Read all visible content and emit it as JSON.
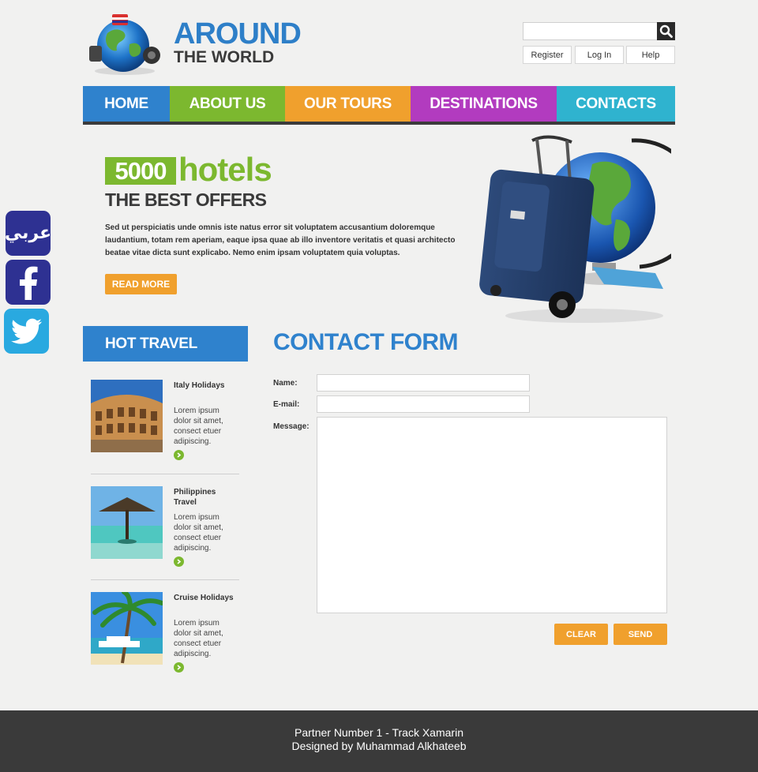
{
  "logo": {
    "line1": "AROUND",
    "line2": "THE WORLD"
  },
  "search": {
    "placeholder": "",
    "value": ""
  },
  "top_links": [
    "Register",
    "Log In",
    "Help"
  ],
  "nav": [
    {
      "label": "HOME",
      "color": "#2f82cd"
    },
    {
      "label": "ABOUT US",
      "color": "#7cb82f"
    },
    {
      "label": "OUR TOURS",
      "color": "#f0a02d"
    },
    {
      "label": "DESTINATIONS",
      "color": "#b23bbf"
    },
    {
      "label": "CONTACTS",
      "color": "#2fb3cf"
    }
  ],
  "hero": {
    "number": "5000",
    "word": "hotels",
    "subtitle": "THE BEST OFFERS",
    "text": "Sed ut perspiciatis unde omnis iste natus error sit voluptatem accusantium doloremque laudantium, totam rem aperiam, eaque ipsa quae ab illo inventore veritatis et quasi architecto beatae vitae dicta sunt explicabo. Nemo enim ipsam voluptatem quia voluptas.",
    "button": "READ MORE"
  },
  "social": {
    "arabic_label": "عربي",
    "colors": {
      "arabic": "#2e3192",
      "facebook": "#2e3192",
      "twitter": "#29a9e0"
    }
  },
  "sidebar": {
    "title": "HOT TRAVEL",
    "items": [
      {
        "title": "Italy Holidays",
        "desc": "Lorem ipsum dolor sit amet, consect etuer adipiscing."
      },
      {
        "title": "Philippines Travel",
        "desc": "Lorem ipsum dolor sit amet, consect etuer adipiscing."
      },
      {
        "title": "Cruise Holidays",
        "desc": "Lorem ipsum dolor sit amet, consect etuer adipiscing."
      }
    ]
  },
  "contact": {
    "title": "CONTACT FORM",
    "name_label": "Name:",
    "email_label": "E-mail:",
    "message_label": "Message:",
    "name_value": "",
    "email_value": "",
    "message_value": "",
    "clear_button": "CLEAR",
    "send_button": "SEND"
  },
  "footer": {
    "line1": "Partner Number 1 - Track Xamarin",
    "line2": "Designed by Muhammad Alkhateeb"
  }
}
